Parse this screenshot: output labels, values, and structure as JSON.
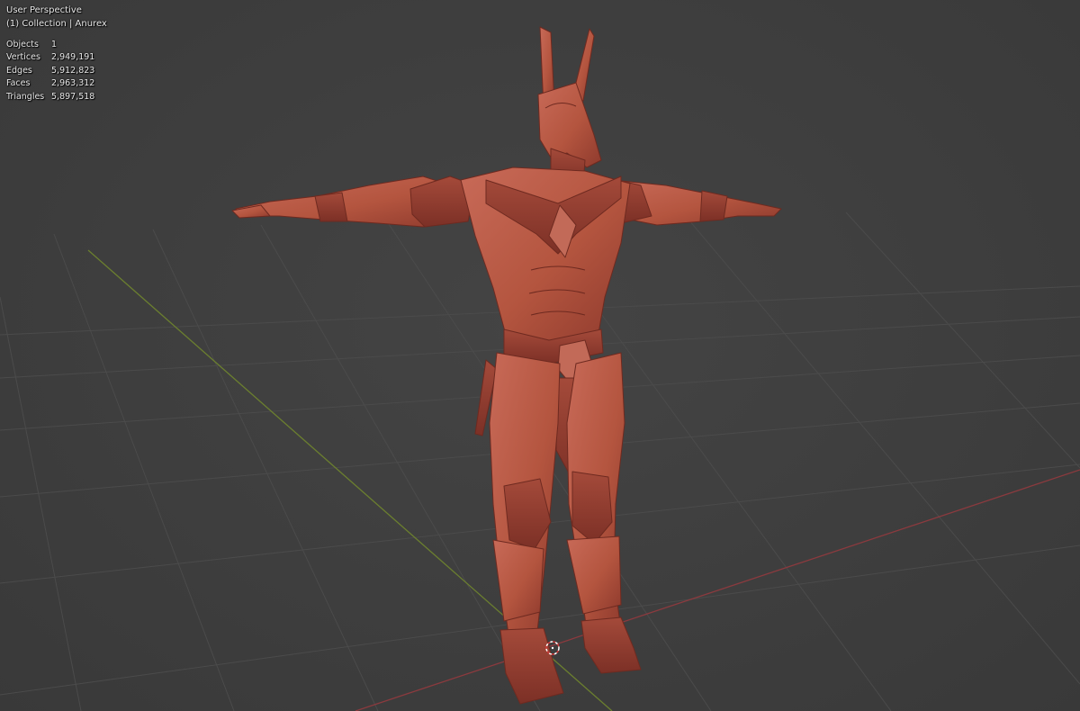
{
  "viewport": {
    "title": "User Perspective",
    "subtitle": "(1) Collection | Anurex"
  },
  "stats": [
    {
      "label": "Objects",
      "value": "1"
    },
    {
      "label": "Vertices",
      "value": "2,949,191"
    },
    {
      "label": "Edges",
      "value": "5,912,823"
    },
    {
      "label": "Faces",
      "value": "2,963,312"
    },
    {
      "label": "Triangles",
      "value": "5,897,518"
    }
  ],
  "colors": {
    "background": "#3d3d3d",
    "grid": "#4a4a4a",
    "x_axis": "#8b3a3e",
    "y_axis": "#6b7f2f",
    "model": "#b9594a"
  },
  "model": {
    "name": "Anurex"
  }
}
